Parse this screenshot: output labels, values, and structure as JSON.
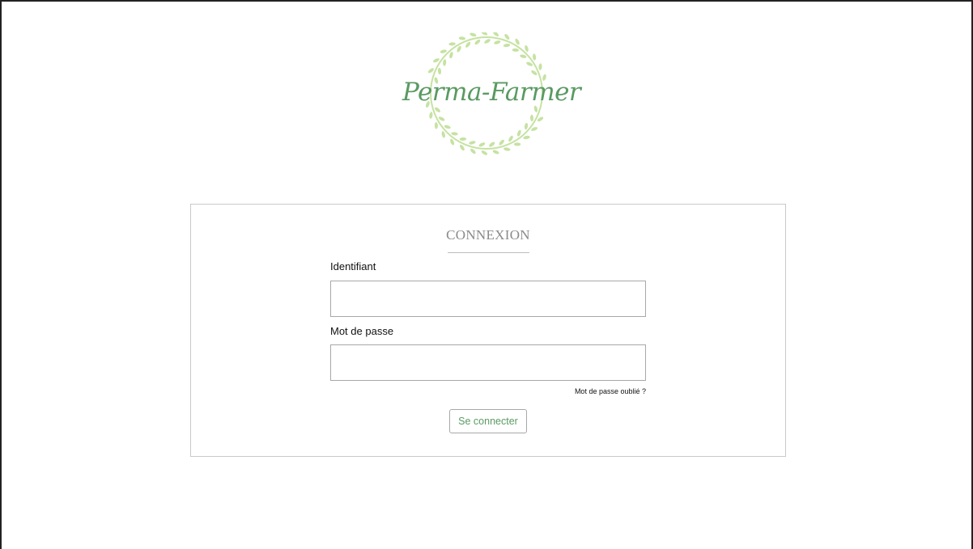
{
  "brand": {
    "name": "Perma-Farmer",
    "logo_icon": "laurel-wreath-icon",
    "text_color": "#5a9a62",
    "wreath_color": "#c6e2a3"
  },
  "login": {
    "title": "CONNEXION",
    "username_label": "Identifiant",
    "username_value": "",
    "password_label": "Mot de passe",
    "password_value": "",
    "forgot_password": "Mot de passe oublié ?",
    "submit_label": "Se connecter"
  }
}
